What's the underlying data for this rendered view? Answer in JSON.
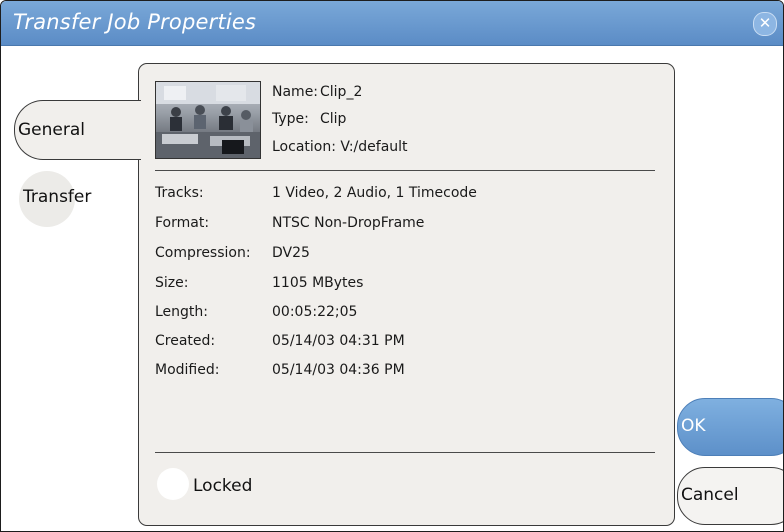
{
  "window": {
    "title": "Transfer Job Properties",
    "close_icon": "close-icon"
  },
  "tabs": {
    "general": "General",
    "transfer": "Transfer"
  },
  "clip": {
    "name_label": "Name:",
    "name": "Clip_2",
    "type_label": "Type:",
    "type": "Clip",
    "location_label": "Location:",
    "location": "V:/default"
  },
  "properties": [
    {
      "label": "Tracks:",
      "value": "1 Video, 2 Audio, 1 Timecode"
    },
    {
      "label": "Format:",
      "value": "NTSC Non-DropFrame"
    },
    {
      "label": "Compression:",
      "value": "DV25"
    },
    {
      "label": "Size:",
      "value": "1105 MBytes"
    },
    {
      "label": "Length:",
      "value": "00:05:22;05"
    },
    {
      "label": "Created:",
      "value": "05/14/03 04:31 PM"
    },
    {
      "label": "Modified:",
      "value": "05/14/03 04:36 PM"
    }
  ],
  "locked_label": "Locked",
  "buttons": {
    "ok": "OK",
    "cancel": "Cancel"
  },
  "colors": {
    "titlebar": "#5b8cc6",
    "panel": "#f1efec",
    "ok_button": "#6a9bd2"
  }
}
